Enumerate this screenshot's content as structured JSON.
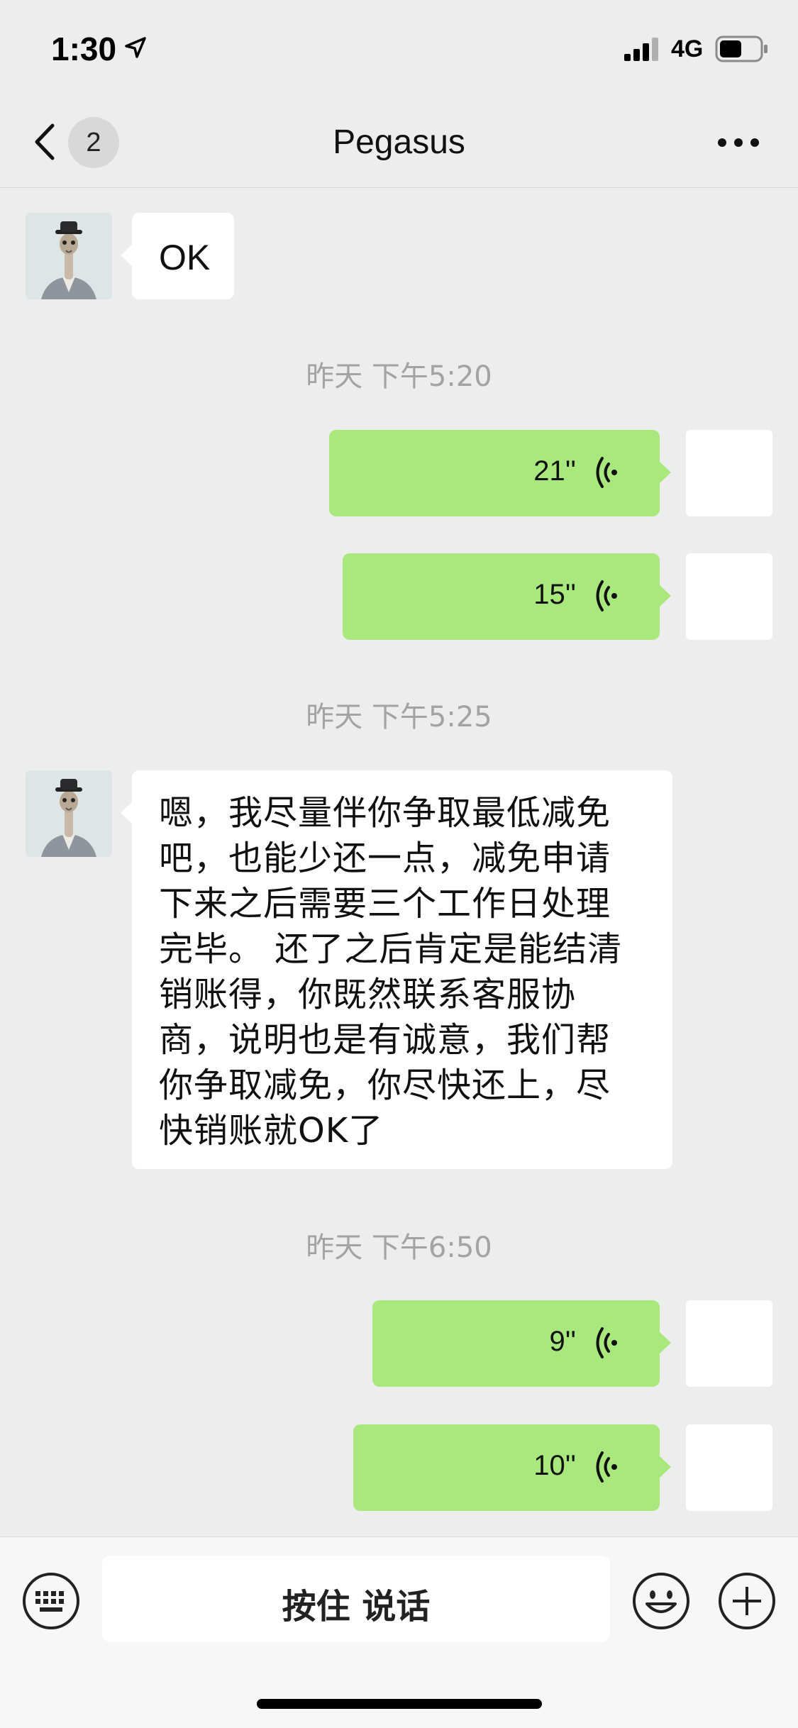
{
  "status_bar": {
    "time": "1:30",
    "network": "4G",
    "icons": [
      "location-arrow-icon",
      "signal-bars-icon",
      "battery-icon"
    ]
  },
  "nav": {
    "unread_count": "2",
    "title": "Pegasus",
    "icons": [
      "chevron-left-icon",
      "more-dots-icon"
    ]
  },
  "messages": [
    {
      "side": "in",
      "type": "text",
      "text": "OK"
    },
    {
      "type": "timestamp",
      "text": "昨天 下午5:20"
    },
    {
      "side": "out",
      "type": "voice",
      "duration": "21''"
    },
    {
      "side": "out",
      "type": "voice",
      "duration": "15''"
    },
    {
      "type": "timestamp",
      "text": "昨天 下午5:25"
    },
    {
      "side": "in",
      "type": "text",
      "text": "嗯，我尽量伴你争取最低减免吧，也能少还一点，减免申请下来之后需要三个工作日处理完毕。 还了之后肯定是能结清销账得，你既然联系客服协商，说明也是有诚意，我们帮你争取减免，你尽快还上，尽快销账就OK了"
    },
    {
      "type": "timestamp",
      "text": "昨天 下午6:50"
    },
    {
      "side": "out",
      "type": "voice",
      "duration": "9''"
    },
    {
      "side": "out",
      "type": "voice",
      "duration": "10''"
    }
  ],
  "input_bar": {
    "hold_to_talk_label": "按住 说话",
    "icons": [
      "keyboard-icon",
      "emoji-icon",
      "plus-icon"
    ]
  },
  "colors": {
    "background": "#ededed",
    "bubble_out": "#a9e87c",
    "bubble_in": "#ffffff",
    "timestamp": "#a3a3a3"
  }
}
